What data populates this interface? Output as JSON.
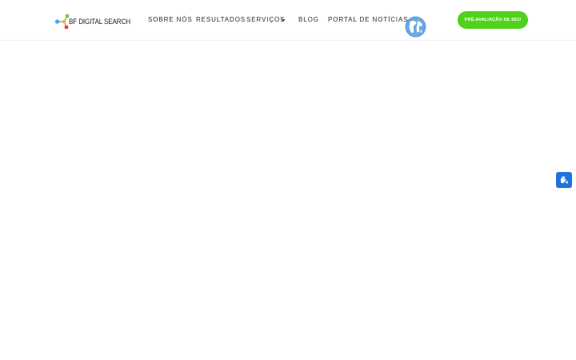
{
  "header": {
    "logo_text": "BF DIGITAL SEARCH",
    "nav": [
      {
        "label": "SOBRE NÓS"
      },
      {
        "label": "RESULTADOS"
      },
      {
        "label": "SERVIÇOS",
        "has_dropdown": true
      },
      {
        "label": "BLOG"
      },
      {
        "label": "PORTAL DE NOTÍCIAS"
      }
    ],
    "cta_label": "PRÉ-AVALIAÇÃO DE SEO"
  },
  "icons": {
    "logo": "bf-logo-icon",
    "dropdown": "chevron-down-icon",
    "language": "globe-icon",
    "accessibility": "sign-language-icon"
  },
  "colors": {
    "cta": "#4fd21c",
    "accessibility_widget": "#1f73d8",
    "globe": "#5b9bdc",
    "nav_text": "#2b2b2b"
  }
}
